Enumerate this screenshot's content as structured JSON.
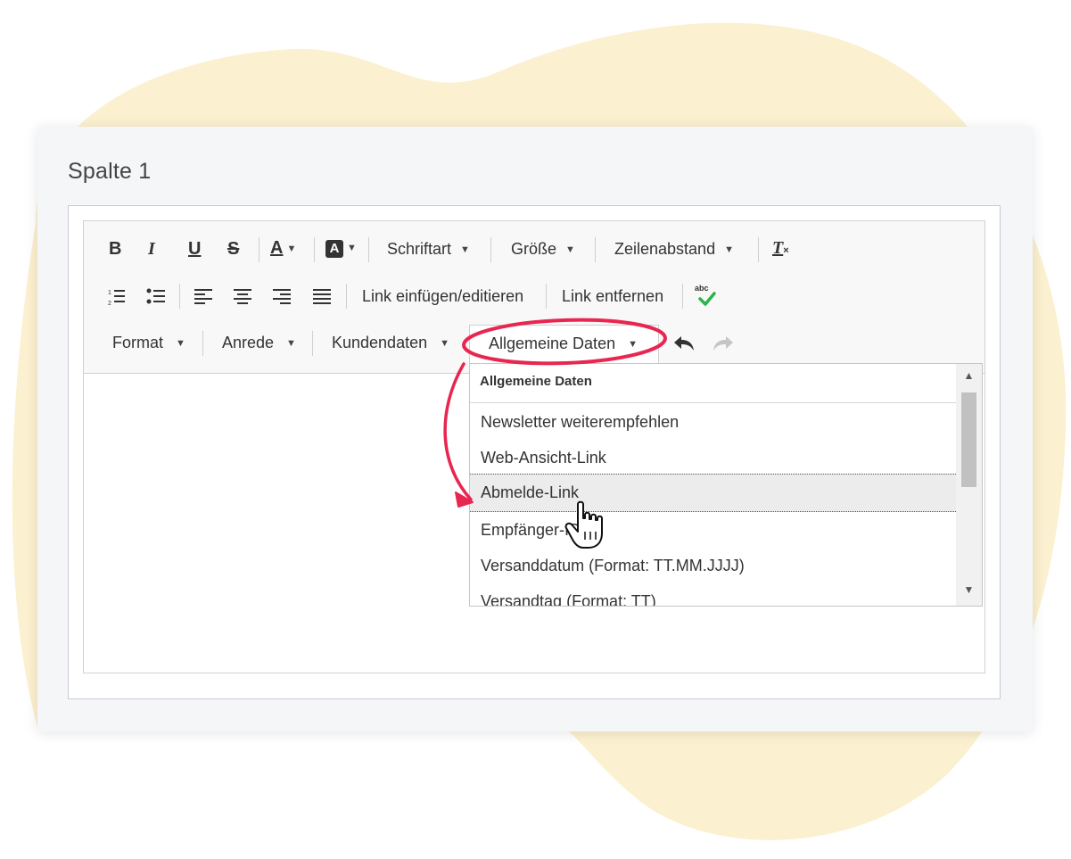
{
  "panel": {
    "column_title": "Spalte 1"
  },
  "toolbar": {
    "row1": {
      "bold": "B",
      "italic": "I",
      "underline": "U",
      "strike": "S",
      "text_color": "A",
      "bg_color": "A",
      "font": "Schriftart",
      "size": "Größe",
      "line_spacing": "Zeilenabstand",
      "clear_format": "T"
    },
    "row2": {
      "link_insert": "Link einfügen/editieren",
      "link_remove": "Link entfernen",
      "spellcheck": "abc"
    },
    "row3": {
      "format": "Format",
      "salutation": "Anrede",
      "customer_data": "Kundendaten",
      "general_data": "Allgemeine Daten"
    }
  },
  "dropdown": {
    "header": "Allgemeine Daten",
    "items": [
      "Newsletter weiterempfehlen",
      "Web-Ansicht-Link",
      "Abmelde-Link",
      "Empfänger-ID",
      "Versanddatum (Format: TT.MM.JJJJ)",
      "Versandtag (Format: TT)"
    ],
    "highlighted_index": 2
  },
  "icons": {
    "cursor": "hand-pointer-icon",
    "annotation": "red-ellipse-and-arrow"
  },
  "colors": {
    "blob": "#fbf0cf",
    "annotation": "#e8264f",
    "panel": "#f5f6f8",
    "spell_check": "#2db34a"
  }
}
